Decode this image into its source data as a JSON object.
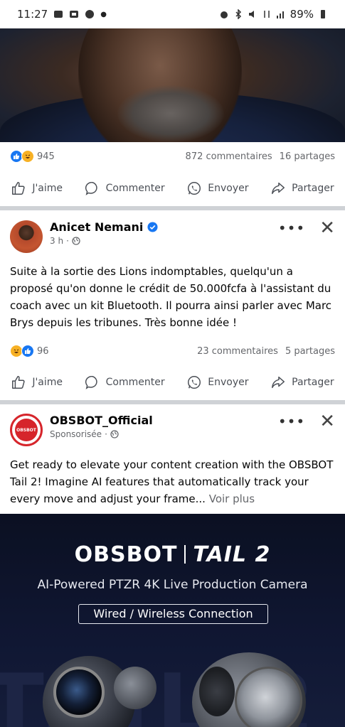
{
  "status_bar": {
    "time": "11:27",
    "battery": "89%"
  },
  "post1": {
    "reactions_count": "945",
    "comments": "872 commentaires",
    "shares": "16 partages",
    "actions": [
      "J'aime",
      "Commenter",
      "Envoyer",
      "Partager"
    ]
  },
  "post2": {
    "author": "Anicet Nemani",
    "time": "3 h",
    "text": "Suite à la sortie des Lions indomptables, quelqu'un a proposé qu'on donne le crédit de 50.000fcfa à l'assistant du coach avec un kit Bluetooth. Il pourra ainsi parler avec Marc Brys depuis les tribunes. Très bonne idée !",
    "reactions_count": "96",
    "comments": "23 commentaires",
    "shares": "5 partages",
    "actions": [
      "J'aime",
      "Commenter",
      "Envoyer",
      "Partager"
    ]
  },
  "post3": {
    "author": "OBSBOT_Official",
    "sponsored": "Sponsorisée",
    "avatar_text": "OBSBOT",
    "text": "Get ready to elevate your content creation with the OBSBOT Tail 2! Imagine AI features that automatically track your every move and adjust your frame...",
    "see_more": "Voir plus",
    "ad": {
      "brand": "OBSBOT",
      "product": "TAIL 2",
      "tagline": "AI-Powered PTZR 4K Live Production Camera",
      "pill": "Wired / Wireless Connection"
    }
  },
  "colors": {
    "like_blue": "#1877f2",
    "haha_yellow": "#f7b125",
    "separator": "#cfd2d6",
    "ad_bg": "#0b1022",
    "obsbot_red": "#d6252b"
  },
  "icons": [
    "like-icon",
    "comment-icon",
    "whatsapp-icon",
    "share-icon",
    "globe-icon",
    "verified-icon",
    "more-icon",
    "close-icon"
  ]
}
